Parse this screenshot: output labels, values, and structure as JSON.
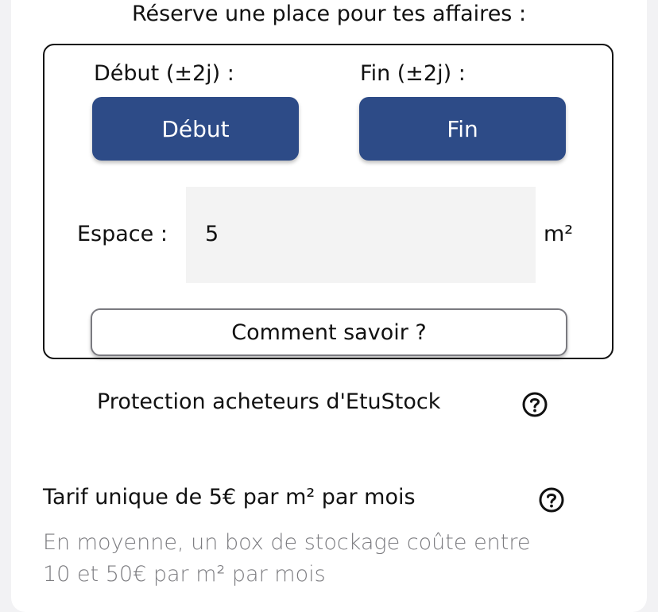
{
  "heading": "Réserve une place pour tes affaires :",
  "start": {
    "label": "Début (±2j) :",
    "button": "Début"
  },
  "end": {
    "label": "Fin (±2j) :",
    "button": "Fin"
  },
  "space": {
    "label": "Espace :",
    "value": "5",
    "unit": "m²"
  },
  "how_button": "Comment savoir ?",
  "protection": {
    "text": "Protection acheteurs d'EtuStock",
    "icon": "help-circle-icon"
  },
  "pricing": {
    "text": "Tarif unique de 5€ par m² par mois",
    "icon": "help-circle-icon",
    "note_line1": "En moyenne, un box de stockage coûte entre",
    "note_line2": "10 et 50€ par m² par mois"
  },
  "colors": {
    "primary_button": "#2d4b87",
    "background": "#f2f2f4",
    "input_bg": "#f3f3f3",
    "muted_text": "#7c7c80"
  }
}
